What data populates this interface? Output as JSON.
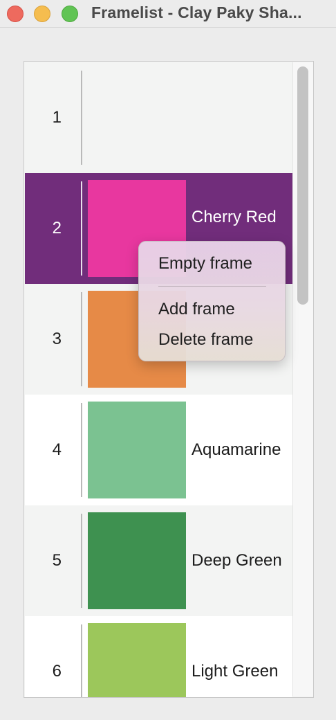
{
  "window": {
    "title": "Framelist - Clay Paky Sha...",
    "controls": {
      "close_color": "#ee6a5e",
      "minimize_color": "#f5bd4f",
      "maximize_color": "#61c454"
    }
  },
  "framelist": {
    "rows": [
      {
        "number": "1",
        "label": "",
        "color": "",
        "selected": false
      },
      {
        "number": "2",
        "label": "Cherry Red",
        "color": "#e8379f",
        "selected": true
      },
      {
        "number": "3",
        "label": "",
        "color": "#e68a47",
        "selected": false
      },
      {
        "number": "4",
        "label": "Aquamarine",
        "color": "#7bc291",
        "selected": false
      },
      {
        "number": "5",
        "label": "Deep Green",
        "color": "#3e9150",
        "selected": false
      },
      {
        "number": "6",
        "label": "Light Green",
        "color": "#9cc75b",
        "selected": false
      }
    ],
    "selection_color": "#712d7b"
  },
  "context_menu": {
    "items": [
      {
        "label": "Empty frame"
      },
      {
        "label": "Add frame"
      },
      {
        "label": "Delete frame"
      }
    ]
  }
}
